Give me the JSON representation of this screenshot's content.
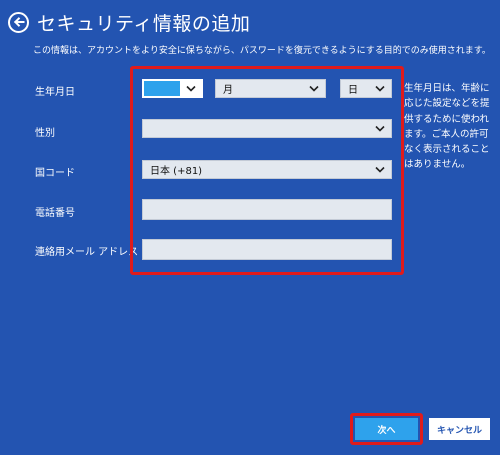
{
  "header": {
    "title": "セキュリティ情報の追加",
    "description": "この情報は、アカウントをより安全に保ちながら、パスワードを復元できるようにする目的でのみ使用されます。"
  },
  "form": {
    "birthdate": {
      "label": "生年月日",
      "year_value": "",
      "month_value": "月",
      "day_value": "日"
    },
    "gender": {
      "label": "性別",
      "value": ""
    },
    "country_code": {
      "label": "国コード",
      "value": "日本 (+81)"
    },
    "phone": {
      "label": "電話番号",
      "value": ""
    },
    "alt_email": {
      "label": "連絡用メール アドレス",
      "value": ""
    }
  },
  "side_note": "生年月日は、年齢に応じた設定などを提供するために使われます。ご本人の許可なく表示されることはありません。",
  "buttons": {
    "next_label": "次へ",
    "cancel_label": "キャンセル"
  },
  "colors": {
    "background": "#2354b1",
    "field": "#e3e8ef",
    "accent": "#2ea2ec",
    "highlight": "#e01b1b"
  }
}
